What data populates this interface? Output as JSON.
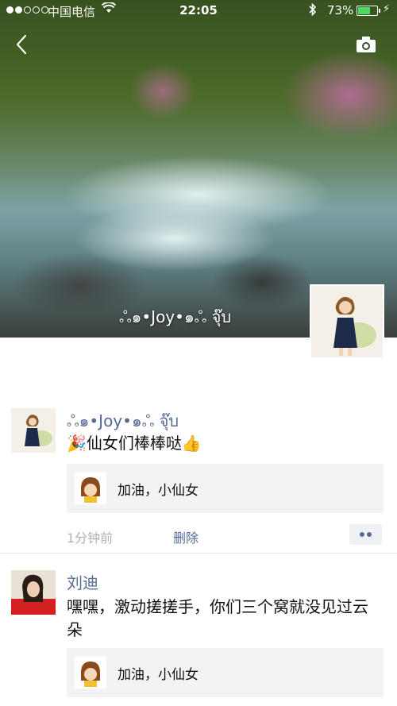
{
  "status_bar": {
    "carrier": "中国电信",
    "wifi_icon": "wifi-icon",
    "time": "22:05",
    "bluetooth_icon": "bluetooth-icon",
    "battery": "73%",
    "battery_level": 0.73,
    "battery_color": "#4cd964"
  },
  "header": {
    "back_icon": "chevron-left-icon",
    "camera_icon": "camera-icon"
  },
  "profile": {
    "name": "ஃ๑•Joy•๑ஃ จุ๊บ"
  },
  "colors": {
    "link": "#576b95",
    "muted": "#b2b2b2",
    "comment_bg": "#f3f3f5"
  },
  "posts": [
    {
      "author": "ஃ๑•Joy•๑ஃ จุ๊บ",
      "text": "🎉仙女们棒棒哒👍",
      "comment": "加油，小仙女",
      "time": "1分钟前",
      "delete_label": "删除"
    },
    {
      "author": "刘迪",
      "text": "嘿嘿，激动搓搓手，你们三个窝就没见过云朵",
      "comment": "加油，小仙女"
    }
  ]
}
